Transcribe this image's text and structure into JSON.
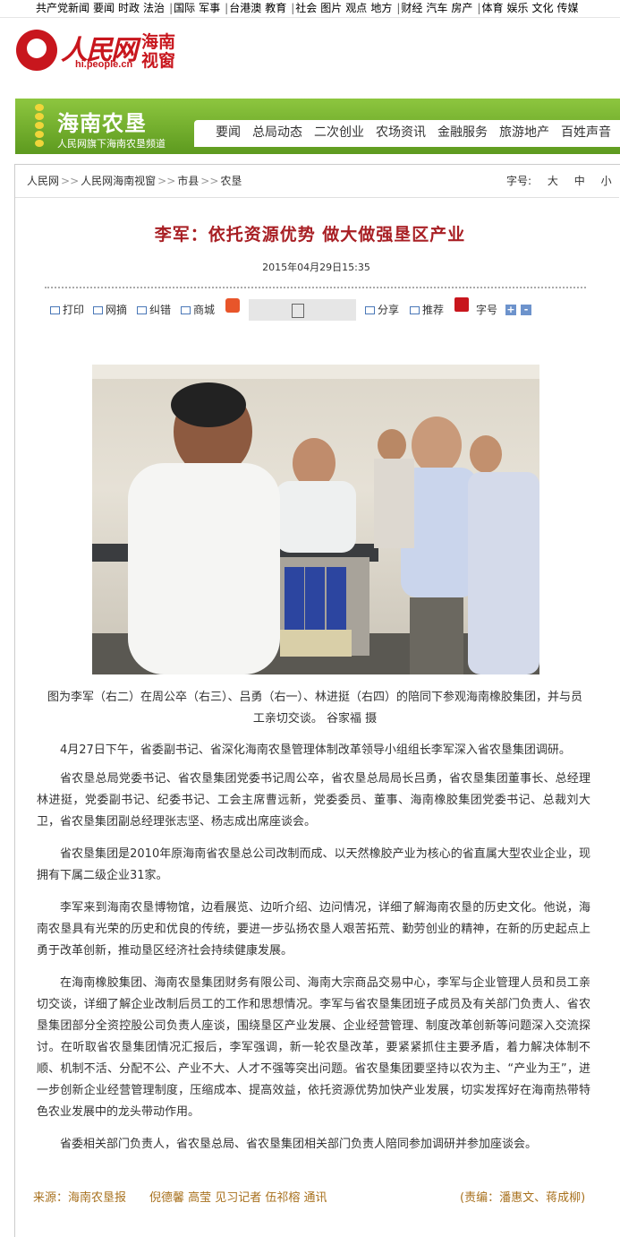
{
  "topnav": {
    "groups": [
      [
        "共产党新闻",
        "要闻",
        "时政",
        "法治"
      ],
      [
        "国际",
        "军事"
      ],
      [
        "台港澳",
        "教育"
      ],
      [
        "社会",
        "图片",
        "观点",
        "地方"
      ],
      [
        "财经",
        "汽车",
        "房产"
      ],
      [
        "体育",
        "娱乐",
        "文化",
        "传媒"
      ]
    ]
  },
  "logo": {
    "brand": "人民网",
    "domain": "hi.people.cn",
    "sub": "海南视窗"
  },
  "banner": {
    "title": "海南农垦",
    "tagline": "人民网旗下海南农垦频道",
    "menu": [
      "要闻",
      "总局动态",
      "二次创业",
      "农场资讯",
      "金融服务",
      "旅游地产",
      "百姓声音"
    ]
  },
  "breadcrumb": [
    "人民网",
    "人民网海南视窗",
    "市县",
    "农垦"
  ],
  "breadcrumb_sep": ">>",
  "font_size": {
    "label": "字号:",
    "options": [
      "大",
      "中",
      "小"
    ]
  },
  "article": {
    "title": "李军：依托资源优势  做大做强垦区产业",
    "date": "2015年04月29日15:35",
    "caption": "图为李军（右二）在周公卒（右三）、吕勇（右一）、林进挺（右四）的陪同下参观海南橡胶集团，并与员工亲切交谈。 谷家福 摄",
    "paragraphs": [
      "4月27日下午，省委副书记、省深化海南农垦管理体制改革领导小组组长李军深入省农垦集团调研。",
      "省农垦总局党委书记、省农垦集团党委书记周公卒，省农垦总局局长吕勇，省农垦集团董事长、总经理林进挺，党委副书记、纪委书记、工会主席曹远新，党委委员、董事、海南橡胶集团党委书记、总裁刘大卫，省农垦集团副总经理张志坚、杨志成出席座谈会。",
      "省农垦集团是2010年原海南省农垦总公司改制而成、以天然橡胶产业为核心的省直属大型农业企业，现拥有下属二级企业31家。",
      "李军来到海南农垦博物馆，边看展览、边听介绍、边问情况，详细了解海南农垦的历史文化。他说，海南农垦具有光荣的历史和优良的传统，要进一步弘扬农垦人艰苦拓荒、勤劳创业的精神，在新的历史起点上勇于改革创新，推动垦区经济社会持续健康发展。",
      "在海南橡胶集团、海南农垦集团财务有限公司、海南大宗商品交易中心，李军与企业管理人员和员工亲切交谈，详细了解企业改制后员工的工作和思想情况。李军与省农垦集团班子成员及有关部门负责人、省农垦集团部分全资控股公司负责人座谈，围绕垦区产业发展、企业经营管理、制度改革创新等问题深入交流探讨。在听取省农垦集团情况汇报后，李军强调，新一轮农垦改革，要紧紧抓住主要矛盾，着力解决体制不顺、机制不活、分配不公、产业不大、人才不强等突出问题。省农垦集团要坚持以农为主、“产业为王”，进一步创新企业经营管理制度，压缩成本、提高效益，依托资源优势加快产业发展，切实发挥好在海南热带特色农业发展中的龙头带动作用。",
      "省委相关部门负责人，省农垦总局、省农垦集团相关部门负责人陪同参加调研并参加座谈会。"
    ],
    "source": "来源：海南农垦报",
    "authors": "倪德馨  高莹  见习记者  伍祁榕  通讯",
    "editor": "(责编：潘惠文、蒋成柳)"
  },
  "tools": {
    "print": "打印",
    "net": "网摘",
    "correct": "纠错",
    "mall": "商城",
    "share": "分享",
    "recommend": "推荐",
    "fontsize": "字号",
    "plus": "+",
    "minus": "-"
  }
}
